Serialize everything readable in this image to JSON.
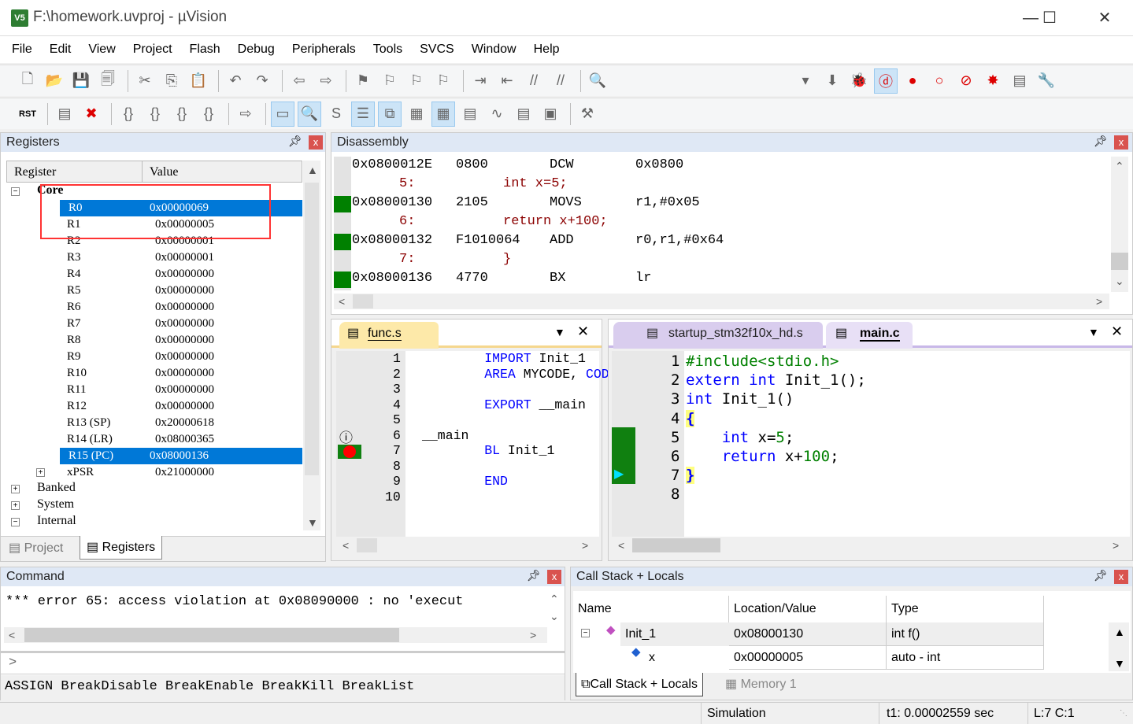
{
  "window": {
    "title": "F:\\homework.uvproj - µVision",
    "app_icon": "uvision-logo",
    "controls": [
      "minimize",
      "maximize",
      "close"
    ]
  },
  "menu": [
    "File",
    "Edit",
    "View",
    "Project",
    "Flash",
    "Debug",
    "Peripherals",
    "Tools",
    "SVCS",
    "Window",
    "Help"
  ],
  "toolbar1": [
    "new-file",
    "open-file",
    "save",
    "save-all",
    "cut",
    "copy",
    "paste",
    "undo",
    "redo",
    "navigate-back",
    "navigate-forward",
    "bookmark",
    "prev-bookmark",
    "next-bookmark",
    "clear-bookmarks",
    "indent",
    "unindent",
    "comment",
    "uncomment",
    "find-in-files"
  ],
  "toolbar2": [
    "reset",
    "run-to-cursor-line",
    "stop",
    "step-into",
    "step-over",
    "step-out",
    "run-to-cursor",
    "show-next-statement",
    "command-window",
    "disassembly-window",
    "symbols-window",
    "registers-window",
    "call-stack-window",
    "watch-window",
    "memory-window",
    "serial-window",
    "analysis-window",
    "trace-window",
    "system-viewer",
    "toolbox"
  ],
  "registers": {
    "title": "Registers",
    "columns": [
      "Register",
      "Value"
    ],
    "group": "Core",
    "rows": [
      [
        "R0",
        "0x00000069"
      ],
      [
        "R1",
        "0x00000005"
      ],
      [
        "R2",
        "0x00000001"
      ],
      [
        "R3",
        "0x00000001"
      ],
      [
        "R4",
        "0x00000000"
      ],
      [
        "R5",
        "0x00000000"
      ],
      [
        "R6",
        "0x00000000"
      ],
      [
        "R7",
        "0x00000000"
      ],
      [
        "R8",
        "0x00000000"
      ],
      [
        "R9",
        "0x00000000"
      ],
      [
        "R10",
        "0x00000000"
      ],
      [
        "R11",
        "0x00000000"
      ],
      [
        "R12",
        "0x00000000"
      ],
      [
        "R13 (SP)",
        "0x20000618"
      ],
      [
        "R14 (LR)",
        "0x08000365"
      ],
      [
        "R15 (PC)",
        "0x08000136"
      ],
      [
        "xPSR",
        "0x21000000"
      ]
    ],
    "selected": [
      "R0",
      "R15 (PC)"
    ],
    "groups": [
      "Banked",
      "System",
      "Internal"
    ],
    "tabs": [
      "Project",
      "Registers"
    ],
    "active_tab": "Registers",
    "highlight_color": "#ff3333"
  },
  "disassembly": {
    "title": "Disassembly",
    "lines": [
      {
        "type": "asm",
        "addr": "0x0800012E",
        "op": "0800",
        "mn": "DCW",
        "args": "0x0800",
        "mark": false
      },
      {
        "type": "src",
        "num": "5:",
        "text": "int x=5;"
      },
      {
        "type": "asm",
        "addr": "0x08000130",
        "op": "2105",
        "mn": "MOVS",
        "args": "r1,#0x05",
        "mark": true
      },
      {
        "type": "src",
        "num": "6:",
        "text": "return x+100;"
      },
      {
        "type": "asm",
        "addr": "0x08000132",
        "op": "F1010064",
        "mn": "ADD",
        "args": "r0,r1,#0x64",
        "mark": true
      },
      {
        "type": "src",
        "num": "7:",
        "text": "}"
      },
      {
        "type": "asm",
        "addr": "0x08000136",
        "op": "4770",
        "mn": "BX",
        "args": "lr",
        "mark": true
      }
    ]
  },
  "func_editor": {
    "tab": "func.s",
    "lines": [
      [
        "1",
        "        ",
        [
          "kw",
          "IMPORT"
        ],
        [
          "t",
          " Init_1"
        ]
      ],
      [
        "2",
        "        ",
        [
          "kw",
          "AREA"
        ],
        [
          "t",
          " MYCODE, "
        ],
        [
          "kw",
          "CODE"
        ]
      ],
      [
        "3",
        ""
      ],
      [
        "4",
        "        ",
        [
          "kw",
          "EXPORT"
        ],
        [
          "t",
          " __main"
        ]
      ],
      [
        "5",
        ""
      ],
      [
        "6",
        "",
        [
          "t",
          "__main"
        ]
      ],
      [
        "7",
        "        ",
        [
          "kw",
          "BL"
        ],
        [
          "t",
          " Init_1"
        ]
      ],
      [
        "8",
        ""
      ],
      [
        "9",
        "        ",
        [
          "kw",
          "END"
        ]
      ],
      [
        "10",
        ""
      ]
    ]
  },
  "main_editor": {
    "tabs": [
      "startup_stm32f10x_hd.s",
      "main.c"
    ],
    "active_tab": "main.c",
    "lines": [
      [
        "1",
        [
          "pp",
          "#include<stdio.h>"
        ]
      ],
      [
        "2",
        [
          "kw",
          "extern"
        ],
        [
          "t",
          " "
        ],
        [
          "kw",
          "int"
        ],
        [
          "t",
          " Init_1();"
        ]
      ],
      [
        "3",
        [
          "kw",
          "int"
        ],
        [
          "t",
          " Init_1()"
        ]
      ],
      [
        "4",
        [
          "br",
          "{"
        ]
      ],
      [
        "5",
        [
          "t",
          "    "
        ],
        [
          "kw",
          "int"
        ],
        [
          "t",
          " x="
        ],
        [
          "num",
          "5"
        ],
        [
          "t",
          ";"
        ]
      ],
      [
        "6",
        [
          "t",
          "    "
        ],
        [
          "kw",
          "return"
        ],
        [
          "t",
          " x+"
        ],
        [
          "num",
          "100"
        ],
        [
          "t",
          ";"
        ]
      ],
      [
        "7",
        [
          "br",
          "}"
        ]
      ],
      [
        "8"
      ]
    ]
  },
  "command": {
    "title": "Command",
    "output": "*** error 65: access violation at 0x08090000 : no 'execut",
    "prompt": ">",
    "hint": "ASSIGN BreakDisable BreakEnable BreakKill BreakList"
  },
  "callstack": {
    "title": "Call Stack + Locals",
    "columns": [
      "Name",
      "Location/Value",
      "Type"
    ],
    "rows": [
      {
        "name": "Init_1",
        "value": "0x08000130",
        "type": "int f()"
      },
      {
        "name": "x",
        "value": "0x00000005",
        "type": "auto - int"
      }
    ],
    "tabs": [
      "Call Stack + Locals",
      "Memory 1"
    ]
  },
  "status": {
    "mode": "Simulation",
    "time": "t1: 0.00002559 sec",
    "pos": "L:7 C:1"
  },
  "colors": {
    "selection": "#0078d7",
    "keyword": "#0000ff",
    "exec_mark": "#008000",
    "source": "#8b0000",
    "panel_header": "#dfe8f5"
  }
}
